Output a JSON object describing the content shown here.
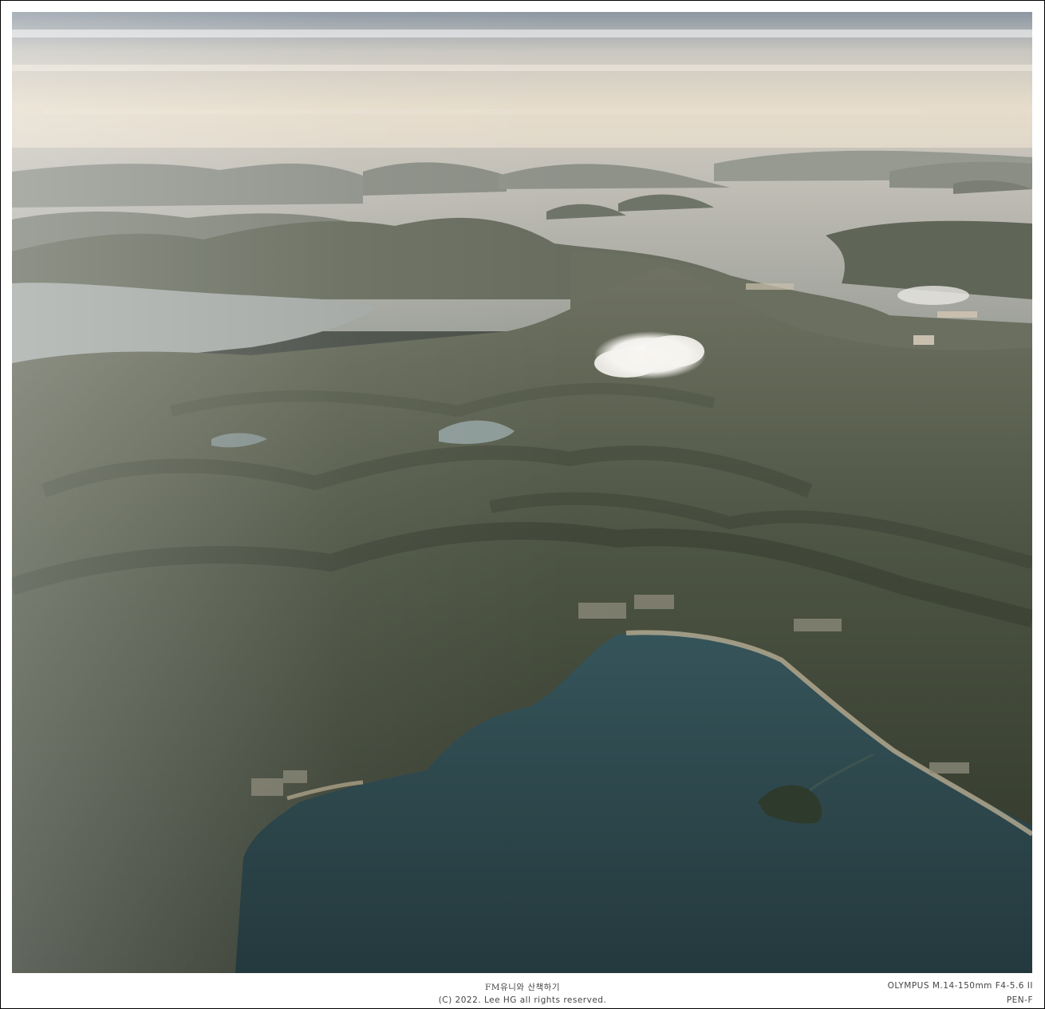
{
  "caption": {
    "blog_name": "FM유니와 산책하기",
    "copyright": "(C) 2022. Lee HG all rights reserved."
  },
  "exif": {
    "lens": "OLYMPUS M.14-150mm F4-5.6 II",
    "camera": "PEN-F"
  }
}
